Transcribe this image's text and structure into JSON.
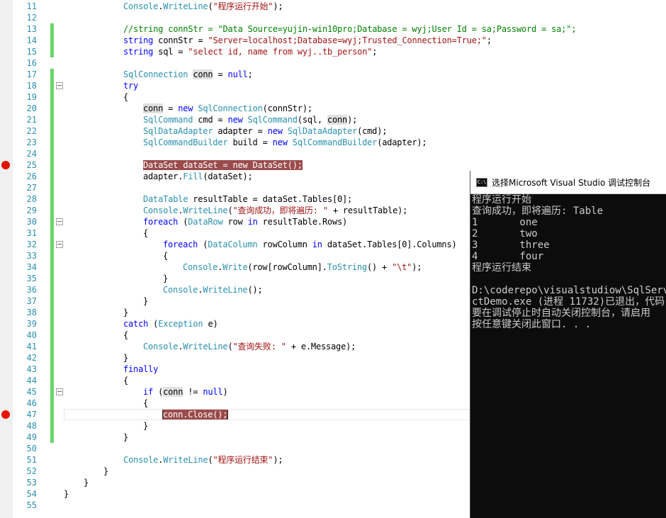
{
  "editor": {
    "lines": [
      {
        "n": "11",
        "segs": [
          [
            "ty",
            "Console"
          ],
          [
            "",
            "."
          ],
          [
            "ty",
            "WriteLine"
          ],
          [
            "",
            "("
          ],
          [
            "str",
            "\"程序运行开始\""
          ],
          [
            "",
            ");"
          ]
        ]
      },
      {
        "n": "12",
        "segs": []
      },
      {
        "n": "13",
        "segs": [
          [
            "cm",
            "//string connStr = \"Data Source=yujin-win10pro;Database = wyj;User Id = sa;Password = sa;\";"
          ]
        ]
      },
      {
        "n": "14",
        "segs": [
          [
            "kw",
            "string"
          ],
          [
            "",
            " connStr = "
          ],
          [
            "str",
            "\"Server=localhost;Database=wyj;Trusted_Connection=True;\""
          ],
          [
            "",
            ";"
          ]
        ]
      },
      {
        "n": "15",
        "segs": [
          [
            "kw",
            "string"
          ],
          [
            "",
            " sql = "
          ],
          [
            "str",
            "\"select id, name from wyj..tb_person\""
          ],
          [
            "",
            ";"
          ]
        ]
      },
      {
        "n": "16",
        "segs": []
      },
      {
        "n": "17",
        "segs": [
          [
            "ty",
            "SqlConnection"
          ],
          [
            "",
            " "
          ],
          [
            "ref",
            "conn"
          ],
          [
            "",
            " = "
          ],
          [
            "kw",
            "null"
          ],
          [
            "",
            ";"
          ]
        ]
      },
      {
        "n": "18",
        "segs": [
          [
            "kw",
            "try"
          ]
        ]
      },
      {
        "n": "19",
        "segs": [
          [
            "",
            "{"
          ]
        ]
      },
      {
        "n": "20",
        "segs": [
          [
            "ref",
            "conn"
          ],
          [
            "",
            " = "
          ],
          [
            "kw",
            "new"
          ],
          [
            "",
            " "
          ],
          [
            "ty",
            "SqlConnection"
          ],
          [
            "",
            "(connStr);"
          ]
        ]
      },
      {
        "n": "21",
        "segs": [
          [
            "ty",
            "SqlCommand"
          ],
          [
            "",
            " cmd = "
          ],
          [
            "kw",
            "new"
          ],
          [
            "",
            " "
          ],
          [
            "ty",
            "SqlCommand"
          ],
          [
            "",
            "(sql, "
          ],
          [
            "ref",
            "conn"
          ],
          [
            "",
            ");"
          ]
        ]
      },
      {
        "n": "22",
        "segs": [
          [
            "ty",
            "SqlDataAdapter"
          ],
          [
            "",
            " adapter = "
          ],
          [
            "kw",
            "new"
          ],
          [
            "",
            " "
          ],
          [
            "ty",
            "SqlDataAdapter"
          ],
          [
            "",
            "(cmd);"
          ]
        ]
      },
      {
        "n": "23",
        "segs": [
          [
            "ty",
            "SqlCommandBuilder"
          ],
          [
            "",
            " build = "
          ],
          [
            "kw",
            "new"
          ],
          [
            "",
            " "
          ],
          [
            "ty",
            "SqlCommandBuilder"
          ],
          [
            "",
            "(adapter);"
          ]
        ]
      },
      {
        "n": "24",
        "segs": []
      },
      {
        "n": "25",
        "segs": [
          [
            "bp",
            "DataSet dataSet = new DataSet();"
          ]
        ]
      },
      {
        "n": "26",
        "segs": [
          [
            "",
            "adapter."
          ],
          [
            "ty",
            "Fill"
          ],
          [
            "",
            "(dataSet);"
          ]
        ]
      },
      {
        "n": "27",
        "segs": []
      },
      {
        "n": "28",
        "segs": [
          [
            "ty",
            "DataTable"
          ],
          [
            "",
            " resultTable = dataSet.Tables[0];"
          ]
        ]
      },
      {
        "n": "29",
        "segs": [
          [
            "ty",
            "Console"
          ],
          [
            "",
            "."
          ],
          [
            "ty",
            "WriteLine"
          ],
          [
            "",
            "("
          ],
          [
            "str",
            "\"查询成功，即将遍历: \""
          ],
          [
            "",
            " + resultTable);"
          ]
        ]
      },
      {
        "n": "30",
        "segs": [
          [
            "kw",
            "foreach"
          ],
          [
            "",
            " ("
          ],
          [
            "ty",
            "DataRow"
          ],
          [
            "",
            " row "
          ],
          [
            "kw",
            "in"
          ],
          [
            "",
            " resultTable.Rows)"
          ]
        ]
      },
      {
        "n": "31",
        "segs": [
          [
            "",
            "{"
          ]
        ]
      },
      {
        "n": "32",
        "segs": [
          [
            "kw",
            "foreach"
          ],
          [
            "",
            " ("
          ],
          [
            "ty",
            "DataColumn"
          ],
          [
            "",
            " rowColumn "
          ],
          [
            "kw",
            "in"
          ],
          [
            "",
            " dataSet.Tables[0].Columns)"
          ]
        ]
      },
      {
        "n": "33",
        "segs": [
          [
            "",
            "{"
          ]
        ]
      },
      {
        "n": "34",
        "segs": [
          [
            "ty",
            "Console"
          ],
          [
            "",
            "."
          ],
          [
            "ty",
            "Write"
          ],
          [
            "",
            "(row[rowColumn]."
          ],
          [
            "ty",
            "ToString"
          ],
          [
            "",
            "() + "
          ],
          [
            "str",
            "\"\\t\""
          ],
          [
            "",
            ");"
          ]
        ]
      },
      {
        "n": "35",
        "segs": [
          [
            "",
            "}"
          ]
        ]
      },
      {
        "n": "36",
        "segs": [
          [
            "ty",
            "Console"
          ],
          [
            "",
            "."
          ],
          [
            "ty",
            "WriteLine"
          ],
          [
            "",
            "();"
          ]
        ]
      },
      {
        "n": "37",
        "segs": [
          [
            "",
            "}"
          ]
        ]
      },
      {
        "n": "38",
        "segs": [
          [
            "",
            "}"
          ]
        ]
      },
      {
        "n": "39",
        "segs": [
          [
            "kw",
            "catch"
          ],
          [
            "",
            " ("
          ],
          [
            "ty",
            "Exception"
          ],
          [
            "",
            " e)"
          ]
        ]
      },
      {
        "n": "40",
        "segs": [
          [
            "",
            "{"
          ]
        ]
      },
      {
        "n": "41",
        "segs": [
          [
            "ty",
            "Console"
          ],
          [
            "",
            "."
          ],
          [
            "ty",
            "WriteLine"
          ],
          [
            "",
            "("
          ],
          [
            "str",
            "\"查询失败: \""
          ],
          [
            "",
            " + e.Message);"
          ]
        ]
      },
      {
        "n": "42",
        "segs": [
          [
            "",
            "}"
          ]
        ]
      },
      {
        "n": "43",
        "segs": [
          [
            "kw",
            "finally"
          ]
        ]
      },
      {
        "n": "44",
        "segs": [
          [
            "",
            "{"
          ]
        ]
      },
      {
        "n": "45",
        "segs": [
          [
            "kw",
            "if"
          ],
          [
            "",
            " ("
          ],
          [
            "ref",
            "conn"
          ],
          [
            "",
            " != "
          ],
          [
            "kw",
            "null"
          ],
          [
            "",
            ")"
          ]
        ]
      },
      {
        "n": "46",
        "segs": [
          [
            "",
            "{"
          ]
        ]
      },
      {
        "n": "47",
        "segs": [
          [
            "sel",
            "conn.Close();"
          ]
        ]
      },
      {
        "n": "48",
        "segs": [
          [
            "",
            "}"
          ]
        ]
      },
      {
        "n": "49",
        "segs": [
          [
            "",
            "}"
          ]
        ]
      },
      {
        "n": "50",
        "segs": []
      },
      {
        "n": "51",
        "segs": [
          [
            "ty",
            "Console"
          ],
          [
            "",
            "."
          ],
          [
            "ty",
            "WriteLine"
          ],
          [
            "",
            "("
          ],
          [
            "str",
            "\"程序运行结束\""
          ],
          [
            "",
            ");"
          ]
        ]
      },
      {
        "n": "52",
        "segs": [
          [
            "",
            "}"
          ]
        ]
      },
      {
        "n": "53",
        "segs": [
          [
            "",
            "}"
          ]
        ]
      },
      {
        "n": "54",
        "segs": [
          [
            "",
            "}"
          ]
        ]
      },
      {
        "n": "55",
        "segs": []
      }
    ]
  },
  "console": {
    "title": "选择Microsoft Visual Studio 调试控制台",
    "icon_text": "C:\\",
    "lines": [
      "程序运行开始",
      "查询成功，即将遍历: Table",
      "1       one",
      "2       two",
      "3       three",
      "4       four",
      "程序运行结束",
      "",
      "D:\\coderepo\\visualstudiow\\SqlServer",
      "ctDemo.exe (进程 11732)已退出，代码",
      "要在调试停止时自动关闭控制台，请启用",
      "按任意键关闭此窗口. . ."
    ]
  }
}
